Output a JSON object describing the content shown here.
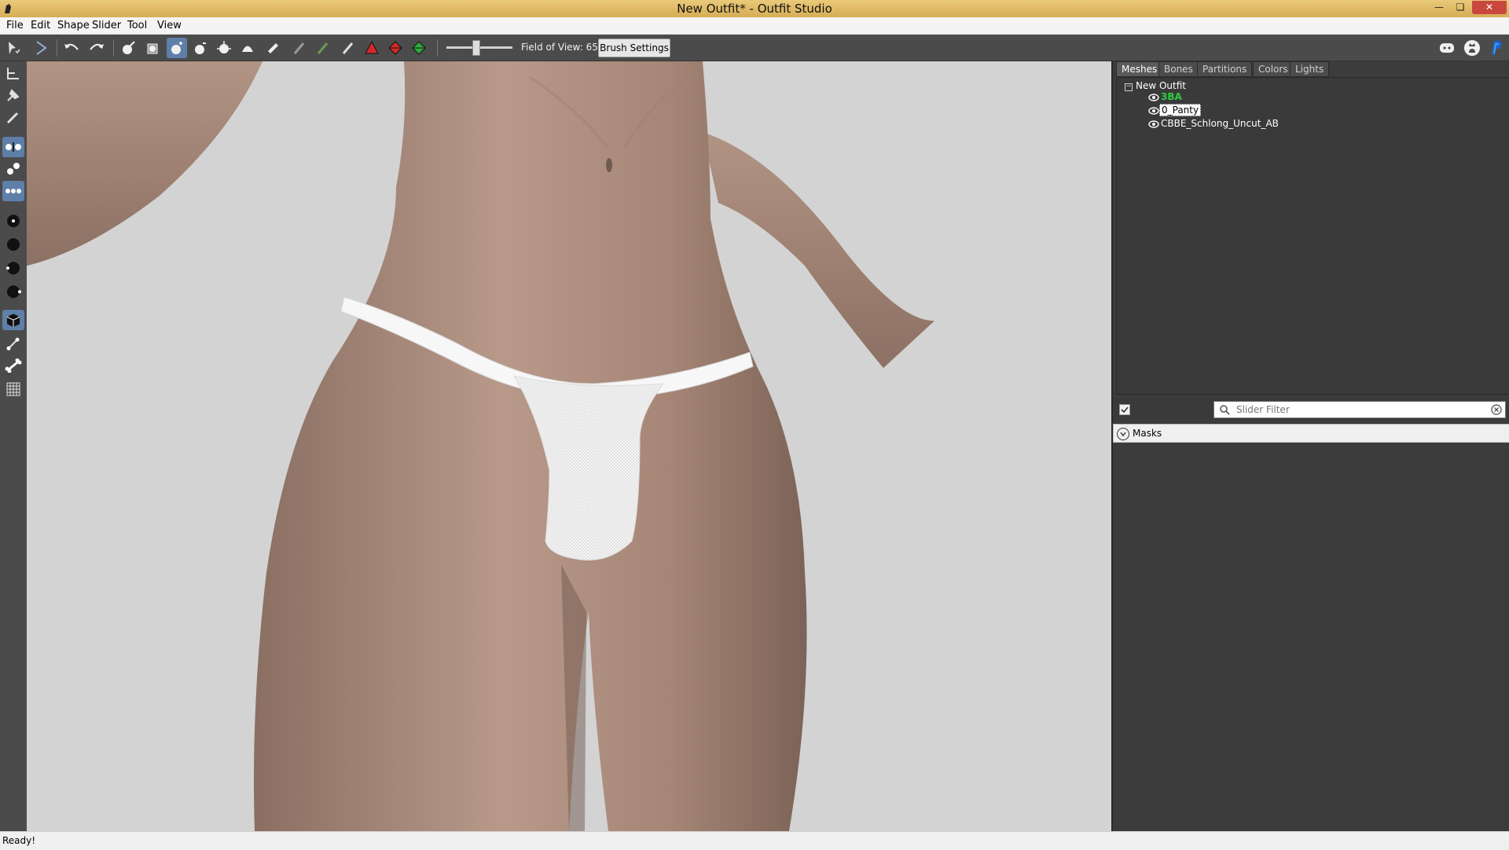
{
  "window": {
    "title": "New Outfit* - Outfit Studio",
    "controls": [
      "minimize",
      "restore",
      "close"
    ]
  },
  "menu": [
    "File",
    "Edit",
    "Shape",
    "Slider",
    "Tool",
    "View"
  ],
  "toolbar": {
    "fov_label": "Field of View: 65",
    "fov_value": 65,
    "brush_settings_label": "Brush Settings",
    "tools": [
      "select-tool-icon",
      "transform-tool-icon",
      "undo-icon",
      "redo-icon",
      "brush-mask-icon",
      "brush-unmask-icon",
      "brush-inflate-icon",
      "brush-deflate-icon",
      "brush-move-icon",
      "brush-smooth-icon",
      "brush-undiff-icon",
      "brush-weight-icon",
      "brush-color-icon",
      "brush-alpha-icon",
      "brush-red-icon",
      "brush-red-green-icon",
      "brush-green-icon"
    ],
    "right_icons": [
      "discord-icon",
      "github-icon",
      "paypal-icon"
    ]
  },
  "left_tools": [
    "transform-icon",
    "pivot-icon",
    "vertex-select-icon",
    "mirror-x-icon",
    "mirror-y-icon",
    "mirror-z-icon",
    "brush-size-small-icon",
    "brush-size-medium-icon",
    "brush-size-large-icon",
    "brush-size-xlarge-icon",
    "cube-icon",
    "edge-icon",
    "bone-icon",
    "grid-icon"
  ],
  "right_panel": {
    "tabs": [
      "Meshes",
      "Bones",
      "Partitions",
      "Colors",
      "Lights"
    ],
    "active_tab": "Meshes",
    "tree": {
      "root": "New Outfit",
      "items": [
        {
          "label": "3BA",
          "color": "#2ecc40"
        },
        {
          "label": "0_Panty",
          "color": "#000000"
        },
        {
          "label": "CBBE_Schlong_Uncut_AB",
          "color": "#ffffff"
        }
      ]
    },
    "slider_filter_placeholder": "Slider Filter",
    "masks_label": "Masks"
  },
  "status": {
    "text": "Ready!"
  },
  "colors": {
    "titlebar": "#d6ad55",
    "toolbar_bg": "#4b4b4b",
    "active_tool": "#5e7fa8",
    "viewport_bg": "#d3d3d3",
    "panel_bg": "#3c3c3c"
  }
}
